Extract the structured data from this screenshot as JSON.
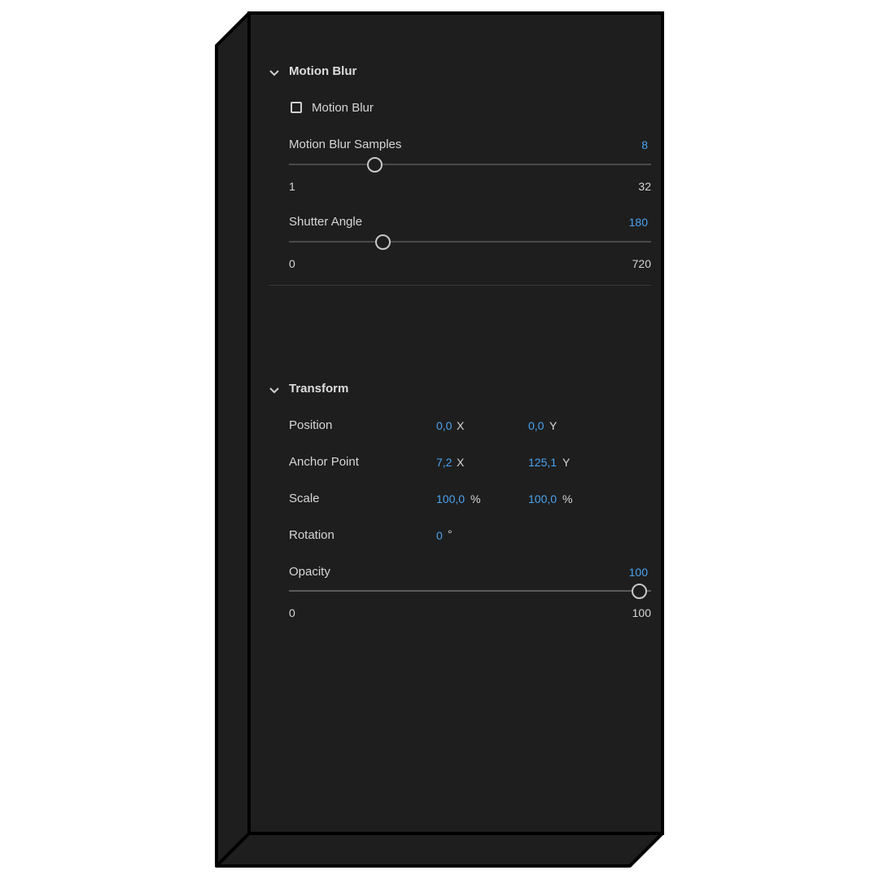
{
  "colors": {
    "panel_bg": "#1e1e1e",
    "accent": "#4aa3f0",
    "text": "#d6d6d6"
  },
  "motion_blur": {
    "section_title": "Motion Blur",
    "checkbox_label": "Motion Blur",
    "checkbox_checked": false,
    "samples": {
      "label": "Motion Blur Samples",
      "value": "8",
      "min": "1",
      "max": "32"
    },
    "shutter_angle": {
      "label": "Shutter Angle",
      "value": "180",
      "min": "0",
      "max": "720"
    }
  },
  "transform": {
    "section_title": "Transform",
    "position": {
      "label": "Position",
      "x": "0,0",
      "x_unit": "X",
      "y": "0,0",
      "y_unit": "Y"
    },
    "anchor_point": {
      "label": "Anchor Point",
      "x": "7,2",
      "x_unit": "X",
      "y": "125,1",
      "y_unit": "Y"
    },
    "scale": {
      "label": "Scale",
      "x": "100,0",
      "x_unit": "%",
      "y": "100,0",
      "y_unit": "%"
    },
    "rotation": {
      "label": "Rotation",
      "value": "0",
      "unit": "°"
    },
    "opacity": {
      "label": "Opacity",
      "value": "100",
      "min": "0",
      "max": "100"
    }
  }
}
